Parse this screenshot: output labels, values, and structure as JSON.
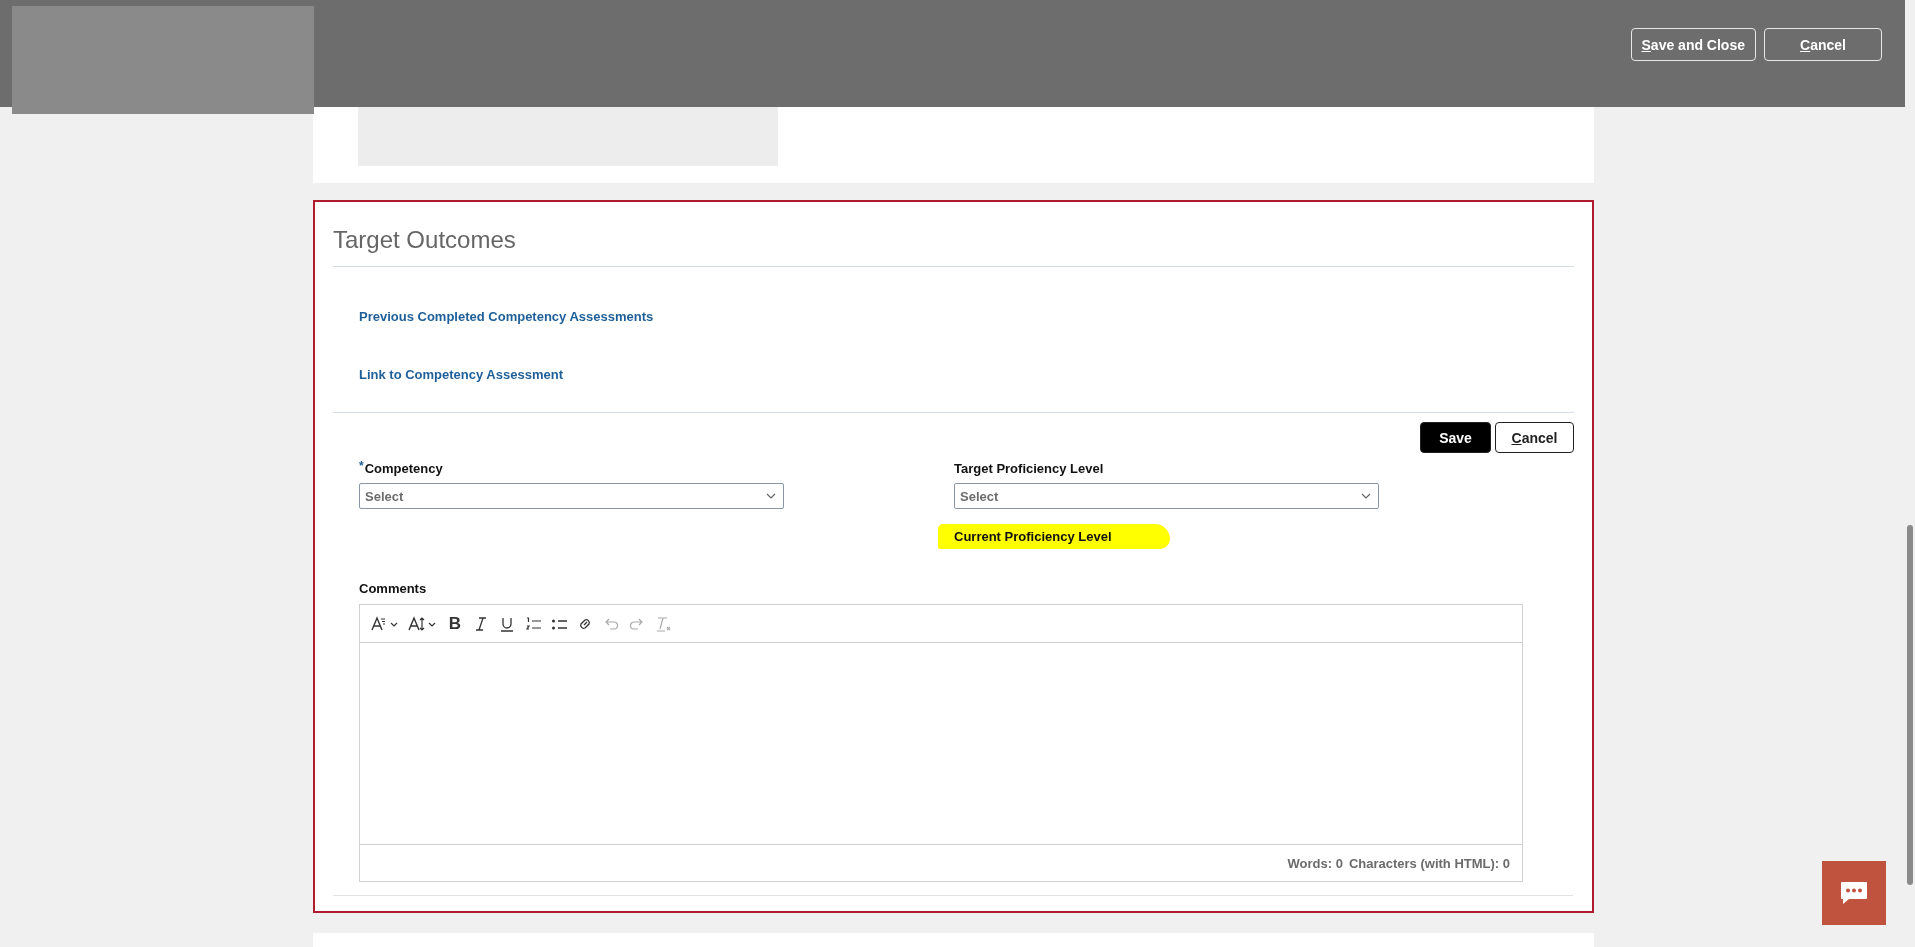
{
  "header": {
    "buttons": [
      {
        "label": "Save and Close",
        "mnemonic": true
      },
      {
        "label": "Cancel",
        "mnemonic": true
      }
    ]
  },
  "section": {
    "title": "Target Outcomes",
    "links": [
      "Previous Completed Competency Assessments",
      "Link to Competency Assessment"
    ],
    "actions": [
      {
        "label": "Save",
        "kind": "primary",
        "mnemonic": false
      },
      {
        "label": "Cancel",
        "kind": "secondary",
        "mnemonic": true
      }
    ],
    "fields": [
      {
        "label": "Competency",
        "required_mark": "*",
        "placeholder": "Select"
      },
      {
        "label": "Target Proficiency Level",
        "placeholder": "Select"
      }
    ],
    "current_proficiency": {
      "label": "Current Proficiency Level",
      "highlighted": true
    },
    "comments": {
      "label": "Comments",
      "toolbar": [
        {
          "kind": "font-style",
          "dropdown": true,
          "disabled": false
        },
        {
          "kind": "font-size",
          "dropdown": true,
          "disabled": false
        },
        {
          "kind": "bold",
          "label": "B",
          "dropdown": false,
          "disabled": false
        },
        {
          "kind": "italic",
          "dropdown": false,
          "disabled": false
        },
        {
          "kind": "underline",
          "dropdown": false,
          "disabled": false
        },
        {
          "kind": "numbered-list",
          "dropdown": false,
          "disabled": false
        },
        {
          "kind": "bullet-list",
          "dropdown": false,
          "disabled": false
        },
        {
          "kind": "link",
          "dropdown": false,
          "disabled": false
        },
        {
          "kind": "undo",
          "dropdown": false,
          "disabled": true
        },
        {
          "kind": "redo",
          "dropdown": false,
          "disabled": true
        },
        {
          "kind": "clear-format",
          "dropdown": false,
          "disabled": true
        }
      ],
      "word_count": "Words: 0",
      "char_count": "Characters (with HTML): 0"
    }
  }
}
